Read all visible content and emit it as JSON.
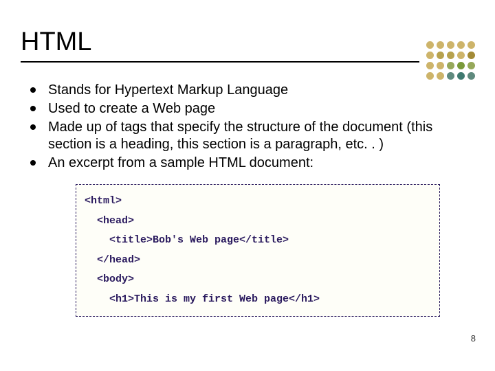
{
  "title": "HTML",
  "bullets": [
    "Stands for Hypertext Markup Language",
    "Used to create a Web page",
    "Made up of tags that specify the structure of the document (this section is a heading, this section is a paragraph, etc. . )",
    "An excerpt from a sample HTML document:"
  ],
  "code": [
    "<html>",
    "  <head>",
    "    <title>Bob's Web page</title>",
    "  </head>",
    "  <body>",
    "    <h1>This is my first Web page</h1>"
  ],
  "page_number": "8",
  "dot_colors": {
    "r0": [
      "#cdb46a",
      "#cdb46a",
      "#cdb46a",
      "#cdb46a",
      "#cdb46a"
    ],
    "r1": [
      "#cdb46a",
      "#b7a24e",
      "#b7a24e",
      "#cdb46a",
      "#a38b37"
    ],
    "r2": [
      "#cdb46a",
      "#cdb46a",
      "#96a85a",
      "#7a9a3a",
      "#96a85a"
    ],
    "r3": [
      "#cdb46a",
      "#cdb46a",
      "#5f8a7e",
      "#3f7a70",
      "#5f8a7e"
    ]
  }
}
